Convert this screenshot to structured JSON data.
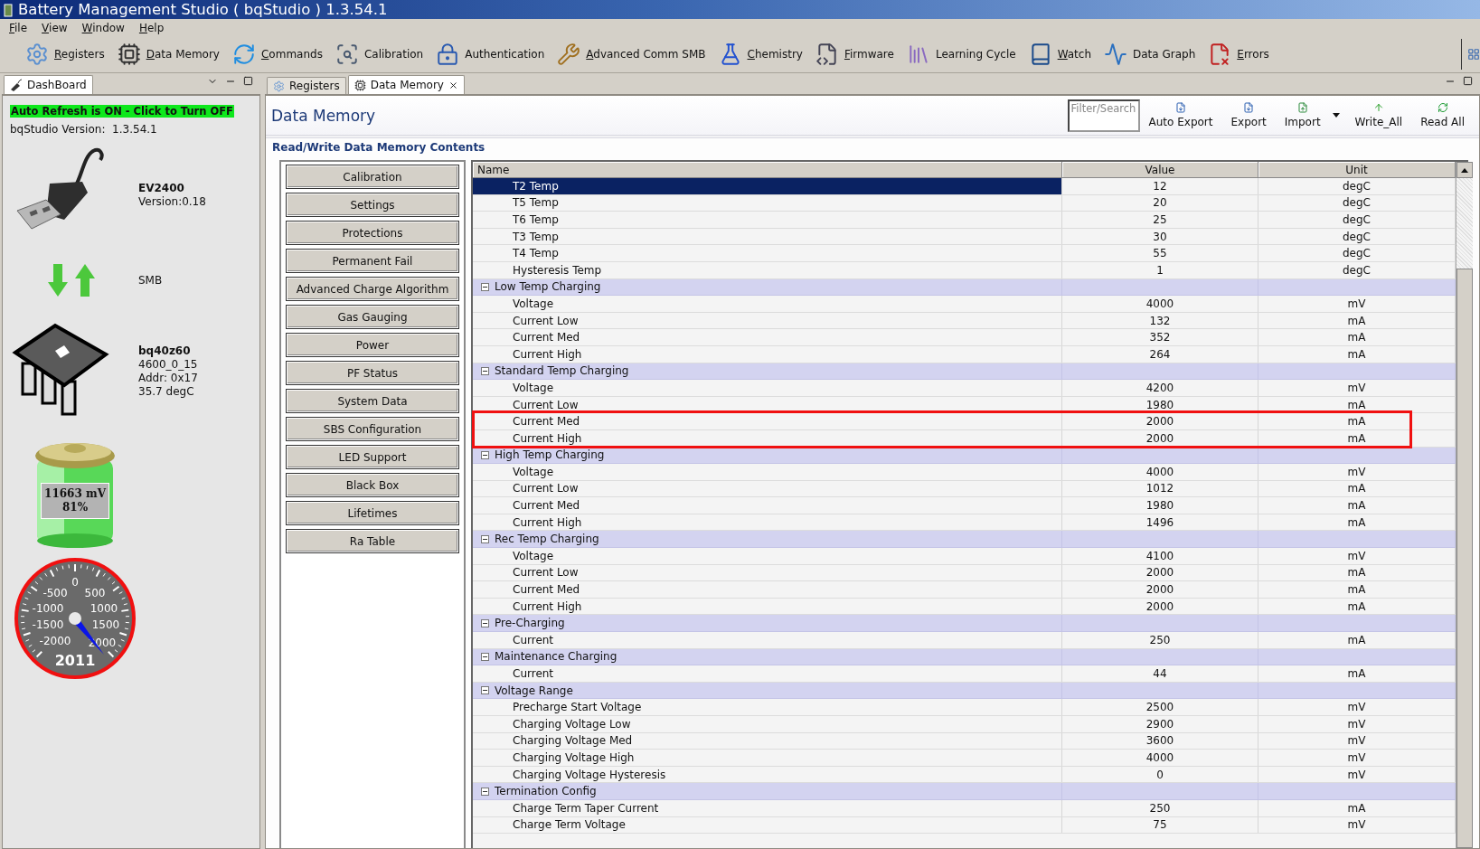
{
  "window": {
    "title": "Battery Management Studio ( bqStudio ) 1.3.54.1"
  },
  "menu": [
    {
      "label": "File",
      "mnemonic": true
    },
    {
      "label": "View",
      "mnemonic": true
    },
    {
      "label": "Window",
      "mnemonic": true
    },
    {
      "label": "Help",
      "mnemonic": true
    }
  ],
  "toolbar": [
    {
      "kind": "gear",
      "label": "Registers",
      "mnemonic": true
    },
    {
      "kind": "chip",
      "label": "Data Memory",
      "mnemonic": true
    },
    {
      "kind": "cycle",
      "label": "Commands",
      "mnemonic": true
    },
    {
      "kind": "magnifier",
      "label": "Calibration",
      "mnemonic": false
    },
    {
      "kind": "lock",
      "label": "Authentication",
      "mnemonic": false
    },
    {
      "kind": "toolbox",
      "label": "Advanced Comm SMB",
      "mnemonic": true
    },
    {
      "kind": "flask",
      "label": "Chemistry",
      "mnemonic": true
    },
    {
      "kind": "firmware",
      "label": "Firmware",
      "mnemonic": true
    },
    {
      "kind": "books",
      "label": "Learning Cycle",
      "mnemonic": false
    },
    {
      "kind": "book",
      "label": "Watch",
      "mnemonic": true
    },
    {
      "kind": "graph",
      "label": "Data Graph",
      "mnemonic": false
    },
    {
      "kind": "errors",
      "label": "Errors",
      "mnemonic": true
    }
  ],
  "dashboard": {
    "tab": {
      "label": "DashBoard",
      "selected": true
    },
    "auto_refresh": "Auto Refresh is ON - Click to Turn OFF",
    "version_label": "bqStudio Version:",
    "version": "1.3.54.1",
    "adapter": {
      "name": "EV2400",
      "version": "Version:0.18"
    },
    "bus": "SMB",
    "device": {
      "name": "bq40z60",
      "lines": [
        "4600_0_15",
        "Addr: 0x17",
        "35.7 degC"
      ]
    },
    "battery": {
      "voltage": "11663 mV",
      "charge": "81%"
    },
    "gauge": {
      "labels": [
        "0",
        "-500",
        "500",
        "-1000",
        "1000",
        "-1500",
        "1500",
        "-2000",
        "2000"
      ],
      "reading": "2011"
    }
  },
  "editor": {
    "tabs": [
      {
        "label": "Registers",
        "kind": "gear",
        "selected": false,
        "closable": false
      },
      {
        "label": "Data Memory",
        "kind": "chip",
        "selected": true,
        "closable": true
      }
    ],
    "title": "Data Memory",
    "filter": {
      "placeholder": "Filter/Search"
    },
    "actions": [
      {
        "label": "Auto Export",
        "kind": "export",
        "dropdown": false
      },
      {
        "label": "Export",
        "kind": "export",
        "dropdown": false
      },
      {
        "label": "Import",
        "kind": "import",
        "dropdown": true
      },
      {
        "label": "Write_All",
        "kind": "write",
        "dropdown": false
      },
      {
        "label": "Read All",
        "kind": "read",
        "dropdown": false
      }
    ],
    "section": "Read/Write Data Memory Contents",
    "categories": [
      "Calibration",
      "Settings",
      "Protections",
      "Permanent Fail",
      "Advanced Charge Algorithm",
      "Gas Gauging",
      "Power",
      "PF Status",
      "System Data",
      "SBS Configuration",
      "LED Support",
      "Black Box",
      "Lifetimes",
      "Ra Table"
    ],
    "table": {
      "columns": [
        "Name",
        "Value",
        "Unit"
      ],
      "rows": [
        {
          "kind": "item",
          "name": "T2 Temp",
          "value": "12",
          "unit": "degC",
          "selected": true
        },
        {
          "kind": "item",
          "name": "T5 Temp",
          "value": "20",
          "unit": "degC",
          "selected": false
        },
        {
          "kind": "item",
          "name": "T6 Temp",
          "value": "25",
          "unit": "degC",
          "selected": false
        },
        {
          "kind": "item",
          "name": "T3 Temp",
          "value": "30",
          "unit": "degC",
          "selected": false
        },
        {
          "kind": "item",
          "name": "T4 Temp",
          "value": "55",
          "unit": "degC",
          "selected": false
        },
        {
          "kind": "item",
          "name": "Hysteresis Temp",
          "value": "1",
          "unit": "degC",
          "selected": false
        },
        {
          "kind": "group",
          "name": "Low Temp Charging",
          "expanded": true,
          "selected": false,
          "children": [
            {
              "kind": "item",
              "name": "Voltage",
              "value": "4000",
              "unit": "mV",
              "selected": false
            },
            {
              "kind": "item",
              "name": "Current Low",
              "value": "132",
              "unit": "mA",
              "selected": false
            },
            {
              "kind": "item",
              "name": "Current Med",
              "value": "352",
              "unit": "mA",
              "selected": false
            },
            {
              "kind": "item",
              "name": "Current High",
              "value": "264",
              "unit": "mA",
              "selected": false
            }
          ]
        },
        {
          "kind": "group",
          "name": "Standard Temp Charging",
          "expanded": true,
          "selected": false,
          "children": [
            {
              "kind": "item",
              "name": "Voltage",
              "value": "4200",
              "unit": "mV",
              "selected": false
            },
            {
              "kind": "item",
              "name": "Current Low",
              "value": "1980",
              "unit": "mA",
              "selected": false
            },
            {
              "kind": "item",
              "name": "Current Med",
              "value": "2000",
              "unit": "mA",
              "selected": false,
              "boxed": true
            },
            {
              "kind": "item",
              "name": "Current High",
              "value": "2000",
              "unit": "mA",
              "selected": false,
              "boxed": true
            }
          ]
        },
        {
          "kind": "group",
          "name": "High Temp Charging",
          "expanded": true,
          "selected": false,
          "children": [
            {
              "kind": "item",
              "name": "Voltage",
              "value": "4000",
              "unit": "mV",
              "selected": false
            },
            {
              "kind": "item",
              "name": "Current Low",
              "value": "1012",
              "unit": "mA",
              "selected": false
            },
            {
              "kind": "item",
              "name": "Current Med",
              "value": "1980",
              "unit": "mA",
              "selected": false
            },
            {
              "kind": "item",
              "name": "Current High",
              "value": "1496",
              "unit": "mA",
              "selected": false
            }
          ]
        },
        {
          "kind": "group",
          "name": "Rec Temp Charging",
          "expanded": true,
          "selected": false,
          "children": [
            {
              "kind": "item",
              "name": "Voltage",
              "value": "4100",
              "unit": "mV",
              "selected": false
            },
            {
              "kind": "item",
              "name": "Current Low",
              "value": "2000",
              "unit": "mA",
              "selected": false
            },
            {
              "kind": "item",
              "name": "Current Med",
              "value": "2000",
              "unit": "mA",
              "selected": false
            },
            {
              "kind": "item",
              "name": "Current High",
              "value": "2000",
              "unit": "mA",
              "selected": false
            }
          ]
        },
        {
          "kind": "group",
          "name": "Pre-Charging",
          "expanded": true,
          "selected": false,
          "children": [
            {
              "kind": "item",
              "name": "Current",
              "value": "250",
              "unit": "mA",
              "selected": false
            }
          ]
        },
        {
          "kind": "group",
          "name": "Maintenance Charging",
          "expanded": true,
          "selected": false,
          "children": [
            {
              "kind": "item",
              "name": "Current",
              "value": "44",
              "unit": "mA",
              "selected": false
            }
          ]
        },
        {
          "kind": "group",
          "name": "Voltage Range",
          "expanded": true,
          "selected": false,
          "children": [
            {
              "kind": "item",
              "name": "Precharge Start Voltage",
              "value": "2500",
              "unit": "mV",
              "selected": false
            },
            {
              "kind": "item",
              "name": "Charging Voltage Low",
              "value": "2900",
              "unit": "mV",
              "selected": false
            },
            {
              "kind": "item",
              "name": "Charging Voltage Med",
              "value": "3600",
              "unit": "mV",
              "selected": false
            },
            {
              "kind": "item",
              "name": "Charging Voltage High",
              "value": "4000",
              "unit": "mV",
              "selected": false
            },
            {
              "kind": "item",
              "name": "Charging Voltage Hysteresis",
              "value": "0",
              "unit": "mV",
              "selected": false
            }
          ]
        },
        {
          "kind": "group",
          "name": "Termination Config",
          "expanded": true,
          "selected": false,
          "children": [
            {
              "kind": "item",
              "name": "Charge Term Taper Current",
              "value": "250",
              "unit": "mA",
              "selected": false
            },
            {
              "kind": "item",
              "name": "Charge Term Voltage",
              "value": "75",
              "unit": "mV",
              "selected": false
            }
          ]
        }
      ]
    }
  }
}
